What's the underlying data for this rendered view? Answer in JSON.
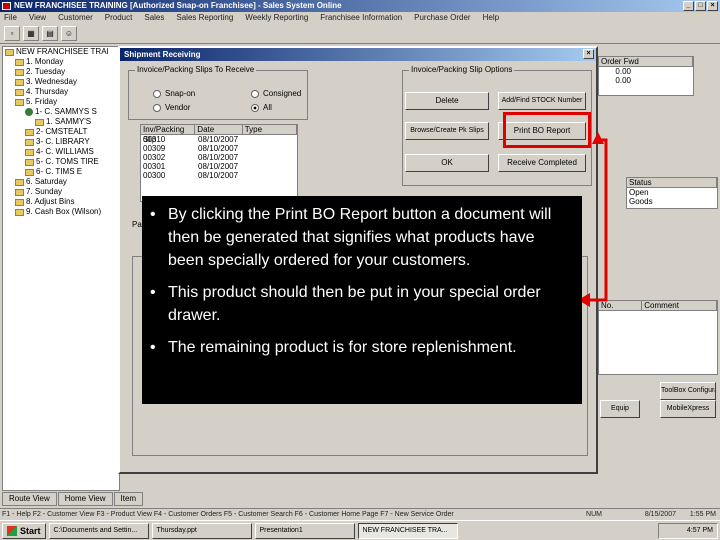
{
  "window": {
    "title": "NEW FRANCHISEE TRAINING [Authorized Snap-on Franchisee] - Sales System Online"
  },
  "menu": [
    "File",
    "View",
    "Customer",
    "Product",
    "Sales",
    "Sales Reporting",
    "Weekly Reporting",
    "Franchisee Information",
    "Purchase Order",
    "Help"
  ],
  "tree": {
    "items": [
      {
        "label": "NEW FRANCHISEE TRAI",
        "indent": 0,
        "kind": "folder"
      },
      {
        "label": "1. Monday",
        "indent": 1,
        "kind": "folder"
      },
      {
        "label": "2. Tuesday",
        "indent": 1,
        "kind": "folder"
      },
      {
        "label": "3. Wednesday",
        "indent": 1,
        "kind": "folder"
      },
      {
        "label": "4. Thursday",
        "indent": 1,
        "kind": "folder"
      },
      {
        "label": "5. Friday",
        "indent": 1,
        "kind": "folder"
      },
      {
        "label": "1- C. SAMMYS S",
        "indent": 2,
        "kind": "leaf"
      },
      {
        "label": "1. SAMMY'S",
        "indent": 3,
        "kind": "folder"
      },
      {
        "label": "2- CMSTEALT",
        "indent": 2,
        "kind": "folder"
      },
      {
        "label": "3- C. LIBRARY",
        "indent": 2,
        "kind": "folder"
      },
      {
        "label": "4- C. WILLIAMS",
        "indent": 2,
        "kind": "folder"
      },
      {
        "label": "5- C. TOMS TIRE",
        "indent": 2,
        "kind": "folder"
      },
      {
        "label": "6- C. TIMS E",
        "indent": 2,
        "kind": "folder"
      },
      {
        "label": "6. Saturday",
        "indent": 1,
        "kind": "folder"
      },
      {
        "label": "7. Sunday",
        "indent": 1,
        "kind": "folder"
      },
      {
        "label": "8. Adjust Bins",
        "indent": 1,
        "kind": "folder"
      },
      {
        "label": "9. Cash Box (Wilson)",
        "indent": 1,
        "kind": "folder"
      }
    ]
  },
  "bottom_tabs": [
    "Route View",
    "Home View",
    "Item"
  ],
  "dialog": {
    "title": "Shipment Receiving",
    "group_left": "Invoice/Packing Slips To Receive",
    "radios": [
      {
        "label": "Snap-on",
        "checked": false
      },
      {
        "label": "Consigned",
        "checked": false
      },
      {
        "label": "Vendor",
        "checked": false
      },
      {
        "label": "All",
        "checked": true
      }
    ],
    "list_headers": [
      "Inv/Packing Slip",
      "Date",
      "Type"
    ],
    "list_rows": [
      {
        "slip": "00310",
        "date": "08/10/2007"
      },
      {
        "slip": "00309",
        "date": "08/10/2007"
      },
      {
        "slip": "00302",
        "date": "08/10/2007"
      },
      {
        "slip": "00301",
        "date": "08/10/2007"
      },
      {
        "slip": "00300",
        "date": "08/10/2007"
      }
    ],
    "group_right": "Invoice/Packing Slip Options",
    "buttons": {
      "delete": "Delete",
      "add_stock": "Add/Find STOCK Number",
      "browse_slips": "Browse/Create Pk Slips",
      "print_bo": "Print BO Report",
      "ok": "OK",
      "receive_completed": "Receive Completed"
    },
    "stub_label": "Pa"
  },
  "right_panel": {
    "col1": "Order Fwd",
    "vals": [
      "0.00",
      "0.00"
    ],
    "status_header": "Status",
    "status_vals": [
      "Open",
      "Goods"
    ],
    "no_header": "No.",
    "comment_header": "Comment",
    "btn_toolbox": "ToolBox Configurator",
    "btn_mobile": "MobileXpress",
    "btn_equip": "Equip"
  },
  "callout": {
    "bullets": [
      "By clicking the Print BO Report button a document will then be generated that signifies what products have been specially ordered for your customers.",
      "This product should then be put in your special order drawer.",
      "The remaining product is for store replenishment."
    ]
  },
  "statusbar": "F1 - Help  F2 - Customer View  F3 - Product View  F4 - Customer Orders  F5 - Customer Search  F6 - Customer Home Page  F7 - New Service Order",
  "status_right": [
    "NUM",
    "8/15/2007",
    "1:55 PM"
  ],
  "taskbar": {
    "start": "Start",
    "tasks": [
      "C:\\Documents and Settin...",
      "Thursday.ppt",
      "Presentation1",
      "NEW FRANCHISEE TRA..."
    ],
    "clock": "4:57 PM"
  },
  "colors": {
    "title_blue": "#0a246a",
    "highlight_red": "#e00000",
    "callout_bg": "#000000"
  }
}
